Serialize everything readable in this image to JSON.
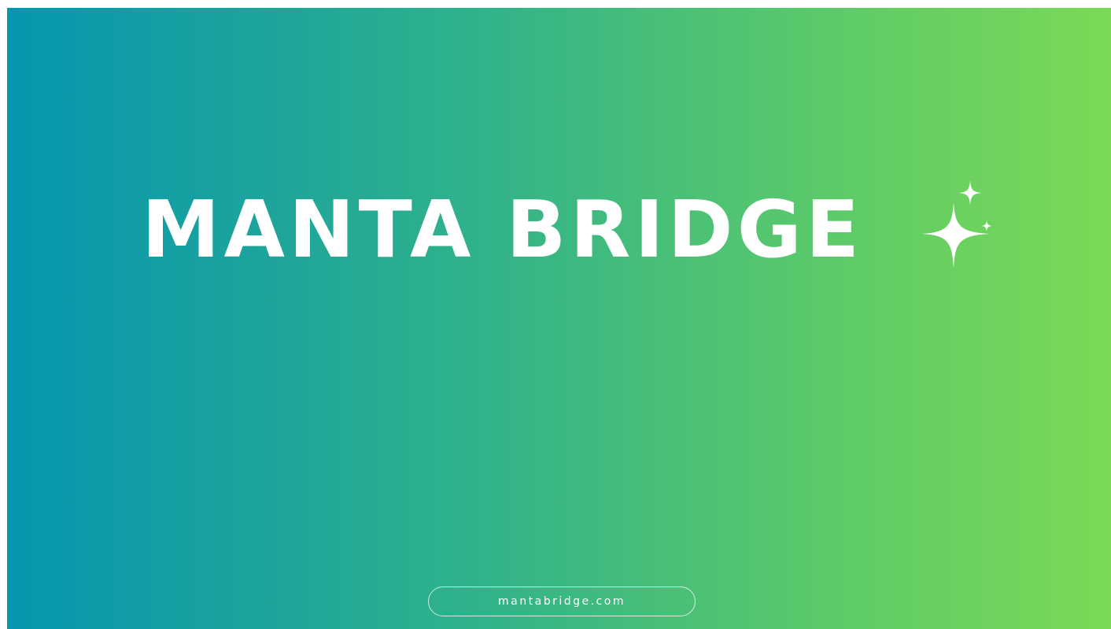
{
  "brand": {
    "title": "MANTA BRIDGE",
    "url": "mantabridge.com"
  },
  "icons": {
    "sparkles": "sparkles-icon"
  },
  "colors": {
    "gradient_start": "#0597b0",
    "gradient_end": "#7ad957",
    "text": "#ffffff"
  }
}
